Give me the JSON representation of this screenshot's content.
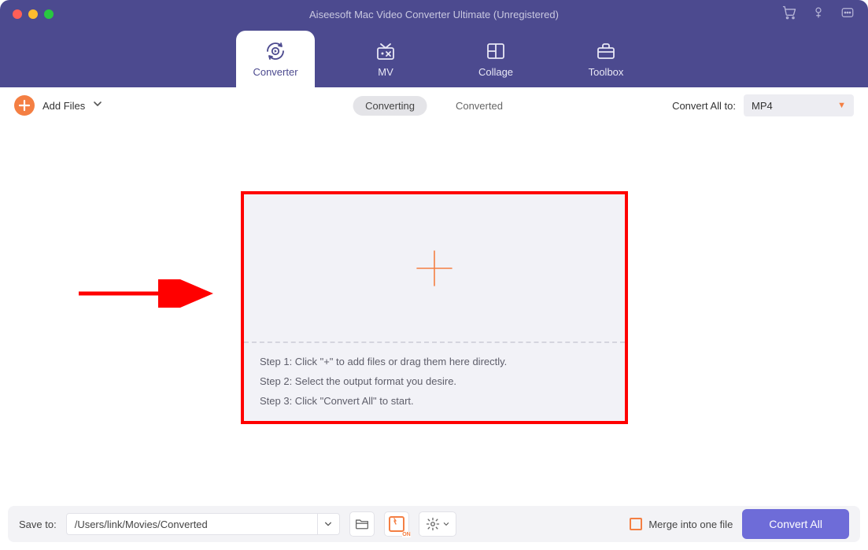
{
  "window": {
    "title": "Aiseesoft Mac Video Converter Ultimate (Unregistered)"
  },
  "tabs": [
    {
      "label": "Converter",
      "active": true
    },
    {
      "label": "MV",
      "active": false
    },
    {
      "label": "Collage",
      "active": false
    },
    {
      "label": "Toolbox",
      "active": false
    }
  ],
  "toolbar": {
    "add_files_label": "Add Files",
    "pills": {
      "converting": "Converting",
      "converted": "Converted"
    },
    "convert_all_to_label": "Convert All to:",
    "format_selected": "MP4"
  },
  "dropzone": {
    "steps": [
      "Step 1: Click \"+\" to add files or drag them here directly.",
      "Step 2: Select the output format you desire.",
      "Step 3: Click \"Convert All\" to start."
    ]
  },
  "footer": {
    "save_to_label": "Save to:",
    "save_path": "/Users/link/Movies/Converted",
    "gpu_on": "ON",
    "merge_label": "Merge into one file",
    "convert_all_button": "Convert All"
  }
}
